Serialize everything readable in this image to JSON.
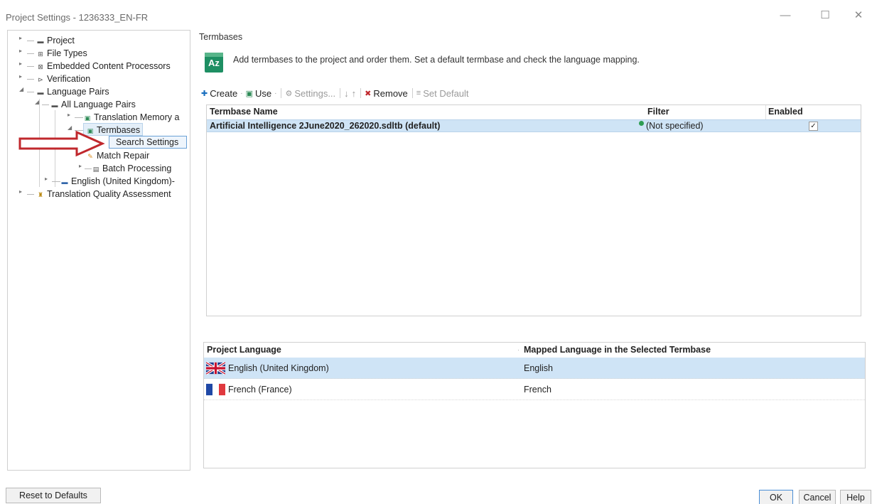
{
  "window": {
    "title": "Project Settings - 1236333_EN-FR",
    "minimize": "—",
    "maximize": "☐",
    "close": "✕"
  },
  "tree": {
    "project": "Project",
    "file_types": "File Types",
    "embedded": "Embedded Content Processors",
    "verification": "Verification",
    "language_pairs": "Language Pairs",
    "all_language_pairs": "All Language Pairs",
    "translation_memory": "Translation Memory a",
    "termbases": "Termbases",
    "search_settings": "Search Settings",
    "match_repair": "Match Repair",
    "batch_processing": "Batch Processing",
    "english_uk_pair": "English (United Kingdom)-",
    "tqa": "Translation Quality Assessment"
  },
  "page": {
    "section_title": "Termbases",
    "icon_text": "Az",
    "description": "Add termbases to the project and order them. Set a default termbase and check the language mapping."
  },
  "toolbar": {
    "create": "Create",
    "use": "Use",
    "settings": "Settings...",
    "down": "↓",
    "up": "↑",
    "remove": "Remove",
    "set_default": "Set Default"
  },
  "termbase_table": {
    "headers": {
      "name": "Termbase Name",
      "filter": "Filter",
      "enabled": "Enabled"
    },
    "rows": [
      {
        "name": "Artificial Intelligence 2June2020_262020.sdltb (default)",
        "filter": "(Not specified)",
        "enabled_mark": "✓"
      }
    ]
  },
  "language_table": {
    "headers": {
      "project_language": "Project Language",
      "mapped_language": "Mapped Language in the Selected Termbase"
    },
    "rows": [
      {
        "project_language": "English (United Kingdom)",
        "mapped_language": "English"
      },
      {
        "project_language": "French (France)",
        "mapped_language": "French"
      }
    ]
  },
  "buttons": {
    "reset": "Reset to Defaults",
    "ok": "OK",
    "cancel": "Cancel",
    "help": "Help"
  },
  "colors": {
    "selection": "#cfe4f6",
    "arrow": "#c0282d",
    "termbase_icon": "#1e8f63"
  }
}
